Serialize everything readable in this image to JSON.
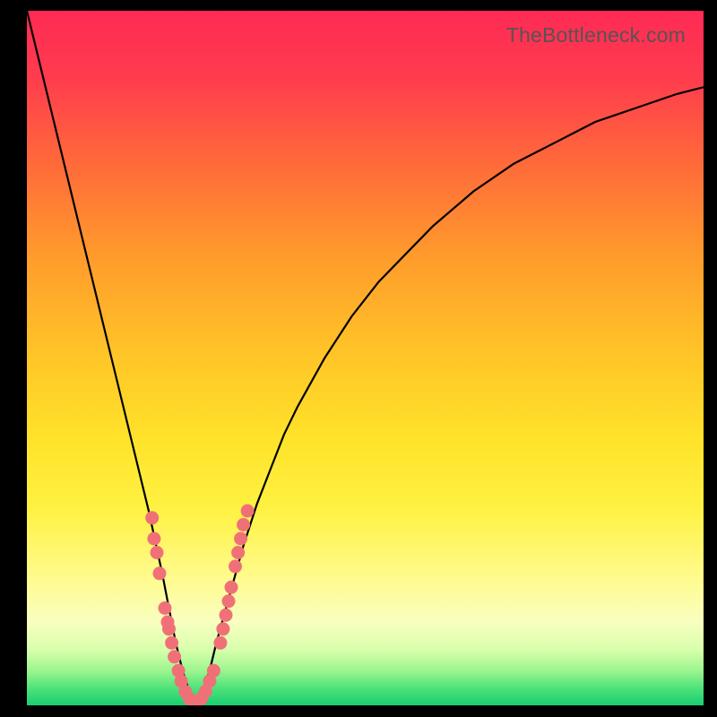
{
  "watermark": "TheBottleneck.com",
  "chart_data": {
    "type": "line",
    "title": "",
    "xlabel": "",
    "ylabel": "",
    "xlim": [
      0,
      100
    ],
    "ylim": [
      0,
      100
    ],
    "series": [
      {
        "name": "bottleneck-curve",
        "x": [
          0,
          2,
          4,
          6,
          8,
          10,
          12,
          14,
          16,
          18,
          20,
          21,
          22,
          23,
          24,
          25,
          26,
          27,
          28,
          30,
          32,
          34,
          36,
          38,
          40,
          44,
          48,
          52,
          56,
          60,
          66,
          72,
          78,
          84,
          90,
          96,
          100
        ],
        "y": [
          100,
          92,
          84,
          76,
          68,
          60,
          52,
          44,
          36,
          28,
          19,
          14,
          9,
          5,
          2,
          0,
          2,
          5,
          9,
          16,
          23,
          29,
          34,
          39,
          43,
          50,
          56,
          61,
          65,
          69,
          74,
          78,
          81,
          84,
          86,
          88,
          89
        ]
      }
    ],
    "markers": {
      "name": "highlighted-points",
      "color": "#f07078",
      "points_xy": [
        [
          18.5,
          27
        ],
        [
          18.8,
          24
        ],
        [
          19.2,
          22
        ],
        [
          19.6,
          19
        ],
        [
          20.4,
          14
        ],
        [
          20.8,
          12
        ],
        [
          21.0,
          11
        ],
        [
          21.4,
          9
        ],
        [
          21.8,
          7
        ],
        [
          22.4,
          5
        ],
        [
          22.8,
          3.5
        ],
        [
          23.4,
          2
        ],
        [
          24.0,
          1
        ],
        [
          24.6,
          0.5
        ],
        [
          25.2,
          0.5
        ],
        [
          25.8,
          1
        ],
        [
          26.4,
          2
        ],
        [
          27.0,
          3.5
        ],
        [
          27.6,
          5
        ],
        [
          28.6,
          9
        ],
        [
          29.0,
          11
        ],
        [
          29.4,
          13
        ],
        [
          29.8,
          15
        ],
        [
          30.2,
          17
        ],
        [
          30.8,
          20
        ],
        [
          31.2,
          22
        ],
        [
          31.6,
          24
        ],
        [
          32.0,
          26
        ],
        [
          32.6,
          28
        ]
      ]
    }
  }
}
